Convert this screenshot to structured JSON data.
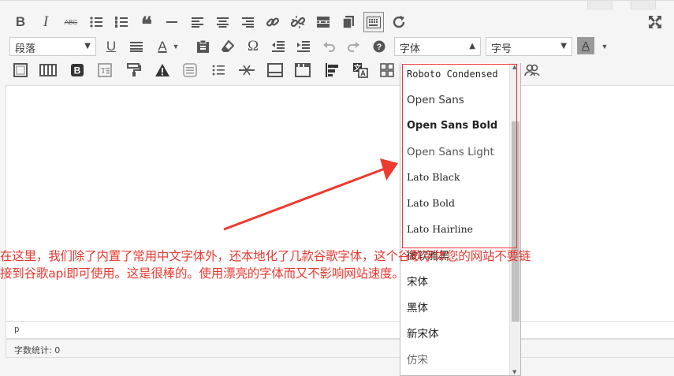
{
  "toolbar": {
    "row1": [
      {
        "name": "bold-button",
        "icon": "bold-icon",
        "glyph": "B"
      },
      {
        "name": "italic-button",
        "icon": "italic-icon",
        "glyph": "I"
      },
      {
        "name": "strikethrough-button",
        "icon": "strikethrough-icon",
        "glyph": "ABC"
      },
      {
        "name": "bullet-list-button",
        "icon": "bullet-list-icon"
      },
      {
        "name": "numbered-list-button",
        "icon": "numbered-list-icon"
      },
      {
        "name": "blockquote-button",
        "icon": "blockquote-icon",
        "glyph": "❝"
      },
      {
        "name": "horizontal-line-button",
        "icon": "horizontal-line-icon"
      },
      {
        "name": "align-left-button",
        "icon": "align-left-icon"
      },
      {
        "name": "align-center-button",
        "icon": "align-center-icon"
      },
      {
        "name": "align-right-button",
        "icon": "align-right-icon"
      },
      {
        "name": "insert-link-button",
        "icon": "link-icon"
      },
      {
        "name": "remove-link-button",
        "icon": "unlink-icon"
      },
      {
        "name": "read-more-button",
        "icon": "read-more-icon"
      },
      {
        "name": "page-break-button",
        "icon": "page-break-icon"
      },
      {
        "name": "toolbar-toggle-button",
        "icon": "keyboard-icon"
      },
      {
        "name": "refresh-button",
        "icon": "refresh-icon"
      }
    ],
    "format_select": {
      "value": "段落"
    },
    "font_select": {
      "value": "字体"
    },
    "size_select": {
      "value": "字号"
    },
    "text_color_glyph": "A",
    "bg_color_glyph": "A",
    "omega_glyph": "Ω"
  },
  "dropdown": {
    "items": [
      {
        "label": "Roboto Condensed",
        "style": "condensed"
      },
      {
        "label": "Open Sans",
        "style": "normal"
      },
      {
        "label": "Open Sans Bold",
        "style": "bold"
      },
      {
        "label": "Open Sans Light",
        "style": "light"
      },
      {
        "label": "Lato Black",
        "style": "serif"
      },
      {
        "label": "Lato Bold",
        "style": "serif"
      },
      {
        "label": "Lato Hairline",
        "style": "serif"
      },
      {
        "label": "微软雅黑",
        "style": "normal"
      },
      {
        "label": "宋体",
        "style": "normal"
      },
      {
        "label": "黑体",
        "style": "normal"
      },
      {
        "label": "新宋体",
        "style": "normal"
      },
      {
        "label": "仿宋",
        "style": "normal"
      }
    ]
  },
  "status": {
    "path": "p",
    "word_count": "字数统计: 0"
  },
  "annotation": {
    "line1": "在这里，我们除了内置了常用中文字体外，还本地化了几款谷歌字体，这个谷歌字体您的网站不要链",
    "line2": "接到谷歌api即可使用。这是很棒的。使用漂亮的字体而又不影响网站速度。",
    "color": "#e8382f"
  }
}
